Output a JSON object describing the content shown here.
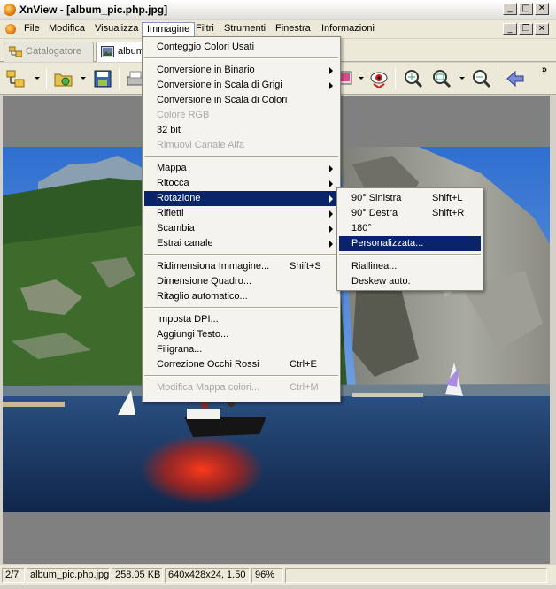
{
  "window": {
    "title": "XnView - [album_pic.php.jpg]",
    "min": "_",
    "max": "□",
    "close": "✕"
  },
  "mdi": {
    "min": "_",
    "restore": "❐",
    "close": "✕"
  },
  "menubar": [
    "File",
    "Modifica",
    "Visualizza",
    "Immagine",
    "Filtri",
    "Strumenti",
    "Finestra",
    "Informazioni"
  ],
  "tabs": [
    {
      "label": "Catalogatore"
    },
    {
      "label": "album_pic.php.jpg"
    }
  ],
  "toolbar": {
    "overflow": "»"
  },
  "immagine_menu": [
    {
      "label": "Conteggio Colori Usati"
    },
    {
      "sep": true
    },
    {
      "label": "Conversione in Binario",
      "sub": true
    },
    {
      "label": "Conversione in Scala di Grigi",
      "sub": true
    },
    {
      "label": "Conversione in Scala di Colori"
    },
    {
      "label": "Colore RGB",
      "disabled": true
    },
    {
      "label": "32 bit"
    },
    {
      "label": "Rimuovi Canale Alfa",
      "disabled": true
    },
    {
      "sep": true
    },
    {
      "label": "Mappa",
      "sub": true
    },
    {
      "label": "Ritocca",
      "sub": true
    },
    {
      "label": "Rotazione",
      "sub": true,
      "highlight": true
    },
    {
      "label": "Rifletti",
      "sub": true
    },
    {
      "label": "Scambia",
      "sub": true
    },
    {
      "label": "Estrai canale",
      "sub": true
    },
    {
      "sep": true
    },
    {
      "label": "Ridimensiona Immagine...",
      "shortcut": "Shift+S"
    },
    {
      "label": "Dimensione Quadro..."
    },
    {
      "label": "Ritaglio automatico..."
    },
    {
      "sep": true
    },
    {
      "label": "Imposta DPI..."
    },
    {
      "label": "Aggiungi Testo..."
    },
    {
      "label": "Filigrana..."
    },
    {
      "label": "Correzione Occhi Rossi",
      "shortcut": "Ctrl+E"
    },
    {
      "sep": true
    },
    {
      "label": "Modifica Mappa colori...",
      "shortcut": "Ctrl+M",
      "disabled": true
    }
  ],
  "rotazione_menu": [
    {
      "label": "90° Sinistra",
      "shortcut": "Shift+L"
    },
    {
      "label": "90° Destra",
      "shortcut": "Shift+R"
    },
    {
      "label": "180°"
    },
    {
      "label": "Personalizzata...",
      "highlight": true
    },
    {
      "sep": true
    },
    {
      "label": "Riallinea..."
    },
    {
      "label": "Deskew auto."
    }
  ],
  "status": {
    "index": "2/7",
    "filename": "album_pic.php.jpg",
    "size": "258.05 KB",
    "dims": "640x428x24, 1.50",
    "zoom": "96%"
  }
}
